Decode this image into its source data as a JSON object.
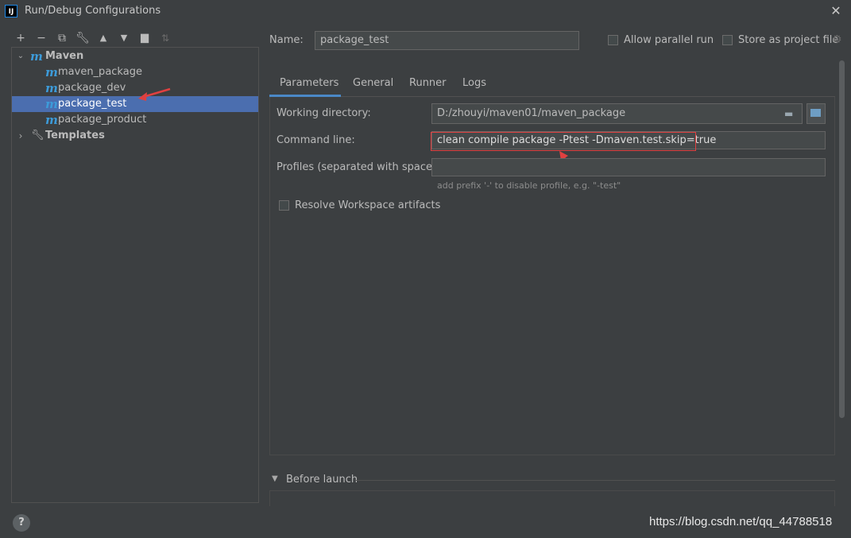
{
  "window": {
    "title": "Run/Debug Configurations",
    "app_icon_text": "IJ"
  },
  "toolbar": {
    "icons": [
      "add-icon",
      "remove-icon",
      "copy-icon",
      "wrench-icon",
      "move-up-icon",
      "move-down-icon",
      "new-folder-icon",
      "sort-icon"
    ]
  },
  "tree": {
    "maven": {
      "label": "Maven",
      "icon": "maven-icon"
    },
    "children": [
      {
        "label": "maven_package",
        "selected": false
      },
      {
        "label": "package_dev",
        "selected": false
      },
      {
        "label": "package_test",
        "selected": true
      },
      {
        "label": "package_product",
        "selected": false
      }
    ],
    "templates": {
      "label": "Templates",
      "icon": "wrench-icon"
    }
  },
  "header": {
    "name_label": "Name:",
    "name_value": "package_test",
    "allow_parallel_label": "Allow parallel run",
    "store_as_project_label": "Store as project file"
  },
  "tabs": [
    {
      "label": "Parameters",
      "active": true
    },
    {
      "label": "General",
      "active": false
    },
    {
      "label": "Runner",
      "active": false
    },
    {
      "label": "Logs",
      "active": false
    }
  ],
  "params": {
    "working_dir_label": "Working directory:",
    "working_dir_value": "D:/zhouyi/maven01/maven_package",
    "command_line_label": "Command line:",
    "command_line_value": "clean compile package -Ptest -Dmaven.test.skip=true",
    "profiles_label": "Profiles (separated with space):",
    "profiles_value": "",
    "profiles_hint": "add prefix '-' to disable profile, e.g. \"-test\"",
    "resolve_label": "Resolve Workspace artifacts"
  },
  "before_launch": {
    "label": "Before launch"
  },
  "footer": {
    "help_label": "?",
    "watermark": "https://blog.csdn.net/qq_44788518"
  },
  "colors": {
    "background": "#3c3f41",
    "selection": "#4b6eaf",
    "accent": "#4a88c7",
    "maven_icon": "#3d9bd9",
    "annotation_red": "#e04040"
  }
}
